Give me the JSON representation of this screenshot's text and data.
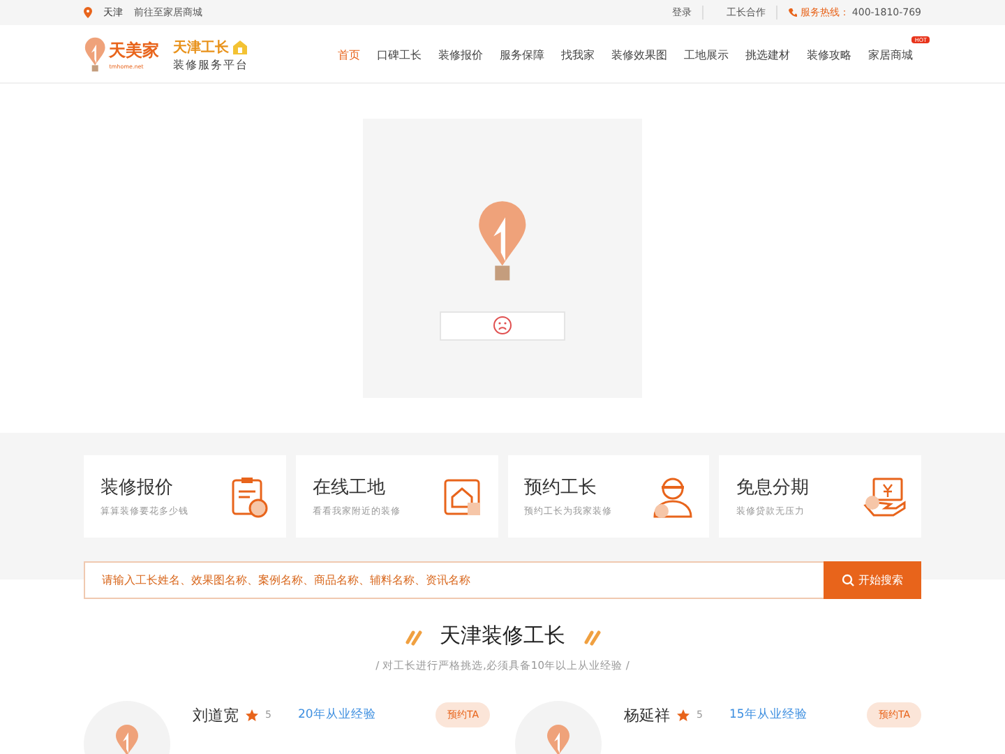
{
  "top_bar": {
    "city": "天津",
    "mall_link": "前往至家居商城",
    "links": [
      "登录",
      "工长合作"
    ],
    "hotline_label": "服务热线：",
    "hotline": "400-1810-769"
  },
  "header": {
    "logo_name": "天美家",
    "logo_domain": "tmhome.net",
    "brand_title": "天津工长",
    "brand_subtitle": "装修服务平台"
  },
  "nav": [
    {
      "label": "首页",
      "selected": true
    },
    {
      "label": "口碑工长",
      "selected": false
    },
    {
      "label": "装修报价",
      "selected": false
    },
    {
      "label": "服务保障",
      "selected": false
    },
    {
      "label": "找我家",
      "selected": false
    },
    {
      "label": "装修效果图",
      "selected": false
    },
    {
      "label": "工地展示",
      "selected": false
    },
    {
      "label": "挑选建材",
      "selected": false
    },
    {
      "label": "装修攻略",
      "selected": false
    },
    {
      "label": "家居商城",
      "selected": false,
      "badge": "HOT"
    }
  ],
  "services": [
    {
      "title": "装修报价",
      "subtitle": "算算装修要花多少钱"
    },
    {
      "title": "在线工地",
      "subtitle": "看看我家附近的装修"
    },
    {
      "title": "预约工长",
      "subtitle": "预约工长为我家装修"
    },
    {
      "title": "免息分期",
      "subtitle": "装修贷款无压力"
    }
  ],
  "search": {
    "placeholder": "请输入工长姓名、效果图名称、案例名称、商品名称、辅料名称、资讯名称",
    "button": "开始搜索"
  },
  "section": {
    "title": "天津装修工长",
    "subtitle": "/ 对工长进行严格挑选,必须具备10年以上从业经验 /"
  },
  "workers": [
    {
      "name": "刘道宽",
      "rating": "5",
      "experience": "20年从业经验",
      "button": "预约TA"
    },
    {
      "name": "杨延祥",
      "rating": "5",
      "experience": "15年从业经验",
      "button": "预约TA"
    }
  ]
}
